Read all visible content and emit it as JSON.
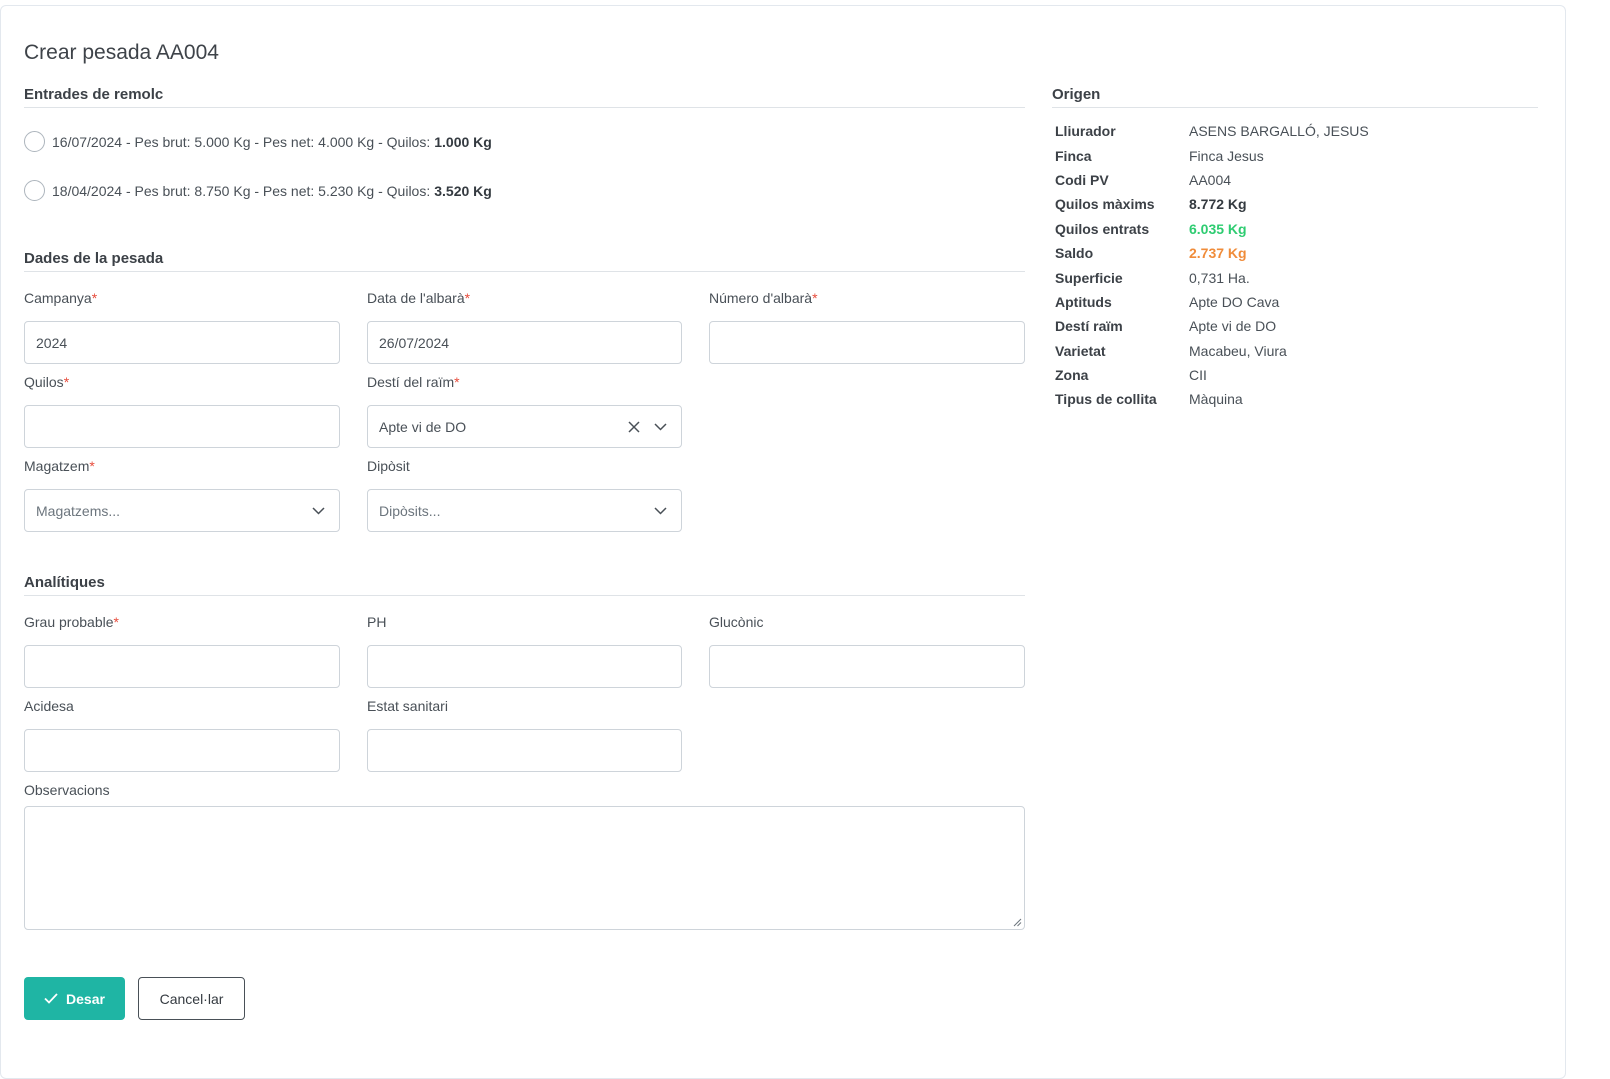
{
  "page_title": "Crear pesada AA004",
  "sections": {
    "trailer_entries": "Entrades de remolc",
    "weighing_data": "Dades de la pesada",
    "analytics": "Analítiques",
    "origin": "Origen"
  },
  "trailer_entries": [
    {
      "text": "16/07/2024 - Pes brut: 5.000 Kg - Pes net: 4.000 Kg - Quilos:",
      "kilos": "1.000 Kg",
      "selected": false
    },
    {
      "text": "18/04/2024 - Pes brut: 8.750 Kg - Pes net: 5.230 Kg - Quilos:",
      "kilos": "3.520 Kg",
      "selected": false
    }
  ],
  "required_mark": "*",
  "fields": {
    "campaign": {
      "label": "Campanya",
      "value": "2024"
    },
    "delivery_date": {
      "label": "Data de l'albarà",
      "value": "26/07/2024"
    },
    "delivery_number": {
      "label": "Número d'albarà",
      "value": ""
    },
    "kilos": {
      "label": "Quilos",
      "value": ""
    },
    "grape_destination": {
      "label": "Destí del raïm",
      "value": "Apte vi de DO"
    },
    "warehouse": {
      "label": "Magatzem",
      "placeholder": "Magatzems..."
    },
    "tank": {
      "label": "Dipòsit",
      "placeholder": "Dipòsits..."
    },
    "probable_degree": {
      "label": "Grau probable",
      "value": ""
    },
    "ph": {
      "label": "PH",
      "value": ""
    },
    "gluconic": {
      "label": "Glucònic",
      "value": ""
    },
    "acidity": {
      "label": "Acidesa",
      "value": ""
    },
    "sanitary_state": {
      "label": "Estat sanitari",
      "value": ""
    },
    "observations": {
      "label": "Observacions",
      "value": ""
    }
  },
  "buttons": {
    "save": "Desar",
    "cancel": "Cancel·lar"
  },
  "origin": [
    {
      "key": "Lliurador",
      "value": "ASENS BARGALLÓ, JESUS",
      "style": "normal"
    },
    {
      "key": "Finca",
      "value": "Finca Jesus",
      "style": "normal"
    },
    {
      "key": "Codi PV",
      "value": "AA004",
      "style": "normal"
    },
    {
      "key": "Quilos màxims",
      "value": "8.772 Kg",
      "style": "bold"
    },
    {
      "key": "Quilos entrats",
      "value": "6.035 Kg",
      "style": "green"
    },
    {
      "key": "Saldo",
      "value": "2.737 Kg",
      "style": "orange"
    },
    {
      "key": "Superficie",
      "value": "0,731 Ha.",
      "style": "normal"
    },
    {
      "key": "Aptituds",
      "value": "Apte DO Cava",
      "style": "normal"
    },
    {
      "key": "Destí raïm",
      "value": "Apte vi de DO",
      "style": "normal"
    },
    {
      "key": "Varietat",
      "value": "Macabeu, Viura",
      "style": "normal"
    },
    {
      "key": "Zona",
      "value": "CII",
      "style": "normal"
    },
    {
      "key": "Tipus de collita",
      "value": "Màquina",
      "style": "normal"
    }
  ],
  "colors": {
    "primary": "#1fb5a4",
    "required": "#e74c3c",
    "success": "#2ecc71",
    "warning": "#f08c3a"
  }
}
